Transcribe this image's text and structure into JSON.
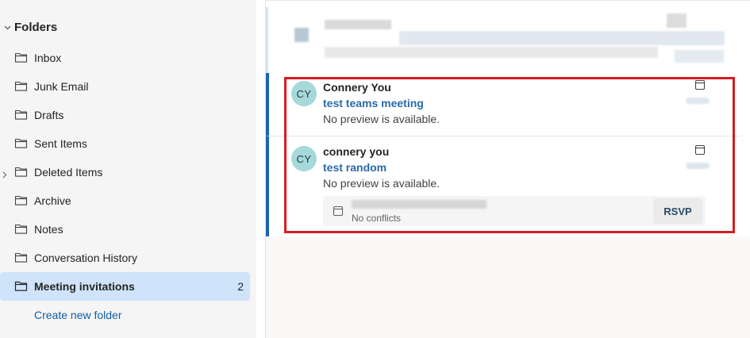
{
  "sidebar": {
    "header": "Folders",
    "items": [
      {
        "label": "Inbox",
        "icon": "folder-icon"
      },
      {
        "label": "Junk Email",
        "icon": "folder-icon"
      },
      {
        "label": "Drafts",
        "icon": "folder-icon"
      },
      {
        "label": "Sent Items",
        "icon": "folder-icon"
      },
      {
        "label": "Deleted Items",
        "icon": "folder-icon",
        "expandable": true
      },
      {
        "label": "Archive",
        "icon": "folder-icon"
      },
      {
        "label": "Notes",
        "icon": "folder-icon"
      },
      {
        "label": "Conversation History",
        "icon": "folder-icon"
      },
      {
        "label": "Meeting invitations",
        "icon": "folder-icon",
        "count": "2",
        "selected": true
      }
    ],
    "create_folder": "Create new folder"
  },
  "messages": [
    {
      "initials": "CY",
      "sender": "Connery You",
      "subject": "test teams meeting",
      "preview": "No preview is available.",
      "icon": "calendar-icon"
    },
    {
      "initials": "CY",
      "sender": "connery you",
      "subject": "test random",
      "preview": "No preview is available.",
      "icon": "calendar-icon",
      "meeting": {
        "status": "No conflicts",
        "rsvp_label": "RSVP"
      }
    }
  ],
  "colors": {
    "selected_folder_bg": "#cfe4fa",
    "accent_bar": "#1e64b4",
    "subject_text": "#2a6aa7",
    "avatar_bg": "#a6d9d9",
    "highlight_border": "#d71b24",
    "link": "#115ea3"
  }
}
